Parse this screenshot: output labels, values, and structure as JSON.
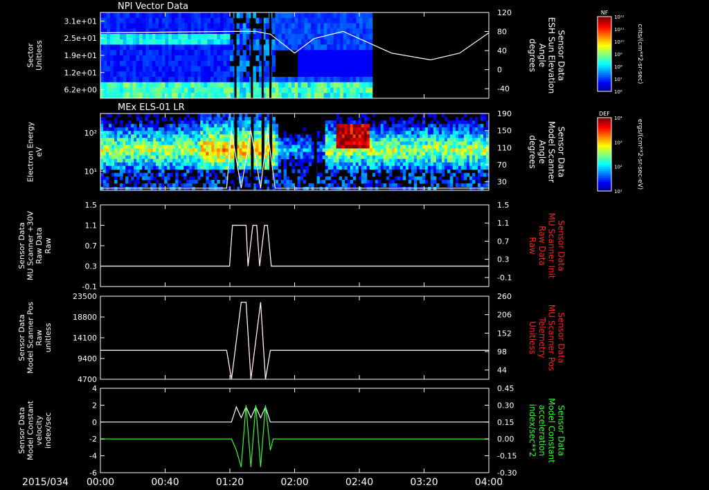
{
  "colors": {
    "background": "#000000",
    "frame": "#ffffff",
    "trace_white": "#ffffff",
    "trace_red": "#ff2020",
    "trace_green": "#30ff30",
    "label_red": "#ff2020",
    "label_green": "#30ff30"
  },
  "time_axis": {
    "start_label": "2015/034",
    "ticks": [
      "00:00",
      "00:40",
      "01:20",
      "02:00",
      "02:40",
      "03:20",
      "04:00"
    ]
  },
  "colorbars": [
    {
      "panel": "NPI Vector Data",
      "title": "NF",
      "ticks": [
        "10¹²",
        "10¹¹",
        "10¹⁰",
        "10⁹",
        "10⁸",
        "10⁷",
        "10⁶"
      ],
      "unit_label": "cnts/(cm**2-sr-sec)"
    },
    {
      "panel": "MEx ELS-01 LR",
      "title": "DEF",
      "ticks": [
        "10⁴",
        "10³",
        "10²",
        "10¹"
      ],
      "unit_label": "ergs/(cm**2-sr-sec-eV)"
    }
  ],
  "chart_data": [
    {
      "type": "heatmap",
      "title": "NPI Vector Data",
      "ylabel": "Sector\nUnitless",
      "y_tick_labels": [
        "3.1e+01",
        "2.5e+01",
        "1.9e+01",
        "1.2e+01",
        "6.2e+00"
      ],
      "right_axis": {
        "label": "Sensor Data\nESH Sun Elevation\nAngle\ndegrees",
        "ylim": [
          -70,
          120
        ],
        "ticks": [
          "120",
          "80",
          "40",
          "0",
          "-40"
        ]
      },
      "x_hours": [
        0,
        1.4,
        1.6,
        1.75,
        2.0,
        2.2,
        2.5,
        3.0,
        3.4,
        3.7,
        4.0
      ],
      "overlay_series": [
        {
          "color": "white",
          "values": [
            75,
            78,
            78,
            72,
            30,
            62,
            78,
            30,
            15,
            30,
            75
          ]
        }
      ]
    },
    {
      "type": "heatmap",
      "title": "MEx ELS-01 LR",
      "ylabel": "Electron Energy\neV",
      "y_tick_labels": [
        "10²",
        "10¹"
      ],
      "right_axis": {
        "label": "Sensor Data\nModel Scanner\nAngle\ndegrees",
        "ylim": [
          10,
          190
        ],
        "ticks": [
          "190",
          "150",
          "110",
          "70",
          "30"
        ]
      },
      "x_hours": [
        0,
        1.3,
        1.35,
        1.45,
        1.55,
        1.65,
        1.72,
        1.8,
        4.0
      ],
      "overlay_series": [
        {
          "color": "white",
          "values": [
            15,
            15,
            150,
            15,
            150,
            15,
            150,
            15,
            15
          ]
        }
      ]
    },
    {
      "type": "line",
      "title": "",
      "ylabel": "Sensor Data\nMU Scanner +30V\nRaw Data\nRaw",
      "ylim": [
        -0.5,
        1.5
      ],
      "y_ticks": [
        "1.5",
        "1.1",
        "0.7",
        "0.3",
        "-0.1"
      ],
      "right_axis": {
        "label": "Sensor Data\nMU Scanner Init\nRaw Data\nRaw",
        "ylim": [
          -0.5,
          1.5
        ],
        "ticks": [
          "1.5",
          "1.1",
          "0.7",
          "0.3",
          "-0.1"
        ]
      },
      "x_hours": [
        0,
        1.33,
        1.36,
        1.5,
        1.52,
        1.57,
        1.61,
        1.64,
        1.69,
        1.72,
        1.76,
        4.0
      ],
      "series": [
        {
          "color": "red",
          "values": [
            0,
            0,
            1,
            1,
            0,
            1,
            1,
            0,
            1,
            1,
            0,
            0
          ]
        },
        {
          "color": "white",
          "values": [
            0,
            0,
            1,
            1,
            0,
            1,
            1,
            0,
            1,
            1,
            0,
            0
          ]
        }
      ]
    },
    {
      "type": "line",
      "title": "",
      "ylabel": "Sensor Data\nModel Scanner Pos\nRaw\nunitless",
      "ylim": [
        0,
        23500
      ],
      "y_ticks": [
        "23500",
        "18800",
        "14100",
        "9400",
        "4700"
      ],
      "right_axis": {
        "label": "Sensor Data\nMU Scanner Pos\nTelemetry\nUnitless",
        "ylim": [
          0,
          260
        ],
        "ticks": [
          "260",
          "206",
          "152",
          "98",
          "44"
        ]
      },
      "x_hours": [
        0,
        1.3,
        1.35,
        1.45,
        1.5,
        1.55,
        1.65,
        1.7,
        1.75,
        4.0
      ],
      "series": [
        {
          "color": "red",
          "values": [
            8200,
            8200,
            0,
            21800,
            21800,
            0,
            21800,
            0,
            8200,
            8200
          ]
        },
        {
          "color": "white",
          "values": [
            8200,
            8200,
            0,
            21800,
            21800,
            0,
            21800,
            0,
            8200,
            8200
          ]
        }
      ]
    },
    {
      "type": "line",
      "title": "",
      "ylabel": "Sensor Data\nModel Constant\nvelocity\nindex/sec",
      "ylim": [
        -6,
        4
      ],
      "y_ticks": [
        "4",
        "2",
        "0",
        "-2",
        "-4",
        "-6"
      ],
      "right_axis": {
        "label": "Sensor Data\nModel Constant\nacceleration\nindex/sec**2",
        "ylim": [
          -0.3,
          0.45
        ],
        "ticks": [
          "0.45",
          "0.30",
          "0.15",
          "0.00",
          "-0.15",
          "-0.30"
        ]
      },
      "x_hours": [
        0,
        1.35,
        1.4,
        1.45,
        1.5,
        1.55,
        1.6,
        1.65,
        1.7,
        1.75,
        1.78,
        4.0
      ],
      "series": [
        {
          "color": "white",
          "axis": "left",
          "values": [
            0,
            0,
            1.8,
            0.5,
            1.8,
            0.5,
            1.8,
            0.5,
            1.8,
            0,
            0,
            0
          ]
        },
        {
          "color": "green",
          "axis": "right",
          "values": [
            0,
            0,
            -0.1,
            -0.25,
            0.3,
            -0.25,
            0.3,
            -0.25,
            0.3,
            -0.1,
            0,
            0
          ]
        }
      ]
    }
  ]
}
